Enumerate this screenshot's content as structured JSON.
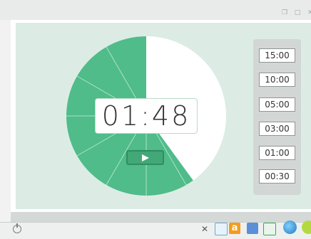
{
  "timer": {
    "display": "01:48",
    "total_seconds": 180,
    "remaining_seconds": 108,
    "colors": {
      "remaining": "#4fbc8a",
      "elapsed": "#ffffff",
      "accent": "#43a878",
      "panel": "#dcece5"
    }
  },
  "presets": [
    "15:00",
    "10:00",
    "05:00",
    "03:00",
    "01:00",
    "00:30"
  ],
  "taskbar": {
    "icons": [
      "close-icon",
      "alarm-clock-icon",
      "alpha-app-icon",
      "puzzle-app-icon",
      "presentation-app-icon",
      "globe-app-icon",
      "smiley-app-icon"
    ]
  }
}
